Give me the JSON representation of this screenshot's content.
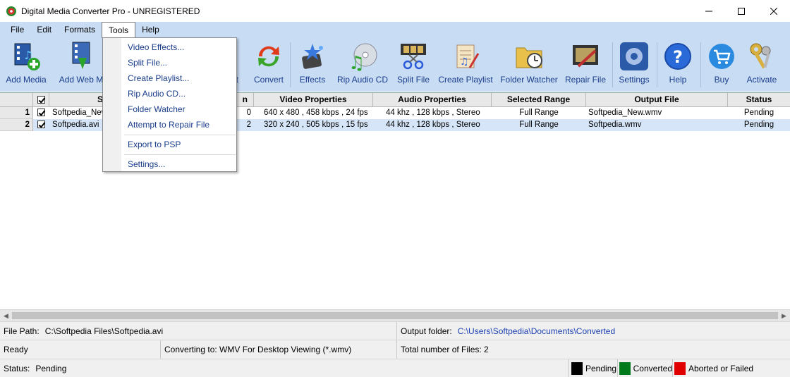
{
  "window": {
    "title": "Digital Media Converter Pro - UNREGISTERED",
    "minimize_icon": "minimize-icon",
    "maximize_icon": "maximize-icon",
    "close_icon": "close-icon"
  },
  "menu": [
    "File",
    "Edit",
    "Formats",
    "Tools",
    "Help"
  ],
  "active_menu": "Tools",
  "toolbar": {
    "add_media": "Add Media",
    "add_web": "Add Web M",
    "format_partial": "at",
    "convert": "Convert",
    "effects": "Effects",
    "rip_audio_cd": "Rip Audio CD",
    "split_file": "Split File",
    "create_playlist": "Create Playlist",
    "folder_watcher": "Folder Watcher",
    "repair_file": "Repair File",
    "settings": "Settings",
    "help": "Help",
    "buy": "Buy",
    "activate": "Activate"
  },
  "tools_menu": {
    "items": [
      "Video Effects...",
      "Split File...",
      "Create Playlist...",
      "Rip Audio CD...",
      "Folder Watcher",
      "Attempt to Repair File",
      "Export to PSP",
      "Settings..."
    ]
  },
  "grid": {
    "columns": {
      "source_partial": "S",
      "duration_partial": "n",
      "video": "Video Properties",
      "audio": "Audio Properties",
      "range": "Selected Range",
      "output": "Output File",
      "status": "Status"
    },
    "rows": [
      {
        "num": "1",
        "source": "Softpedia_New",
        "dur": "0",
        "video": "640 x 480 , 458 kbps , 24 fps",
        "audio": "44 khz , 128 kbps , Stereo",
        "range": "Full Range",
        "output": "Softpedia_New.wmv",
        "status": "Pending"
      },
      {
        "num": "2",
        "source": "Softpedia.avi",
        "dur": "2",
        "video": "320 x 240 , 505 kbps , 15 fps",
        "audio": "44 khz , 128 kbps , Stereo",
        "range": "Full Range",
        "output": "Softpedia.wmv",
        "status": "Pending"
      }
    ]
  },
  "status": {
    "file_path_label": "File Path:",
    "file_path": "C:\\Softpedia Files\\Softpedia.avi",
    "output_folder_label": "Output folder:",
    "output_folder": "C:\\Users\\Softpedia\\Documents\\Converted",
    "ready": "Ready",
    "converting_to": "Converting to: WMV For Desktop Viewing (*.wmv)",
    "total_files": "Total number of Files: 2",
    "status_label": "Status:",
    "status_value": "Pending",
    "legend": [
      {
        "color": "#000000",
        "label": "Pending"
      },
      {
        "color": "#007a1a",
        "label": "Converted"
      },
      {
        "color": "#e00000",
        "label": "Aborted or Failed"
      }
    ]
  }
}
